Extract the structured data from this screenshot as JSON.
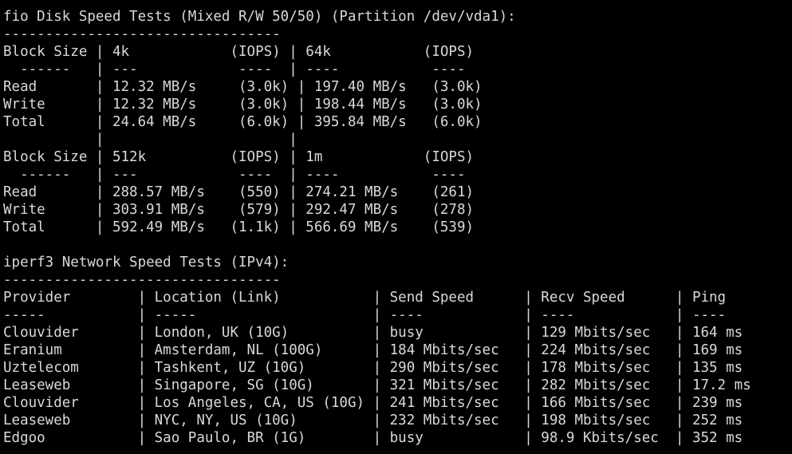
{
  "terminal": {
    "lines": [
      "fio Disk Speed Tests (Mixed R/W 50/50) (Partition /dev/vda1):",
      "---------------------------------",
      "Block Size | 4k            (IOPS) | 64k           (IOPS)",
      "  ------   | ---            ----  | ----           ----",
      "Read       | 12.32 MB/s     (3.0k) | 197.40 MB/s   (3.0k)",
      "Write      | 12.32 MB/s     (3.0k) | 198.44 MB/s   (3.0k)",
      "Total      | 24.64 MB/s     (6.0k) | 395.84 MB/s   (6.0k)",
      "           |                      |",
      "Block Size | 512k          (IOPS) | 1m            (IOPS)",
      "  ------   | ---            ----  | ----           ----",
      "Read       | 288.57 MB/s    (550) | 274.21 MB/s    (261)",
      "Write      | 303.91 MB/s    (579) | 292.47 MB/s    (278)",
      "Total      | 592.49 MB/s   (1.1k) | 566.69 MB/s    (539)",
      "",
      "iperf3 Network Speed Tests (IPv4):",
      "---------------------------------",
      "Provider        | Location (Link)           | Send Speed      | Recv Speed      | Ping",
      "-----           | -----                     | ----            | ----            | ----",
      "Clouvider       | London, UK (10G)          | busy            | 129 Mbits/sec   | 164 ms",
      "Eranium         | Amsterdam, NL (100G)      | 184 Mbits/sec   | 224 Mbits/sec   | 169 ms",
      "Uztelecom       | Tashkent, UZ (10G)        | 290 Mbits/sec   | 178 Mbits/sec   | 135 ms",
      "Leaseweb        | Singapore, SG (10G)       | 321 Mbits/sec   | 282 Mbits/sec   | 17.2 ms",
      "Clouvider       | Los Angeles, CA, US (10G) | 241 Mbits/sec   | 166 Mbits/sec   | 239 ms",
      "Leaseweb        | NYC, NY, US (10G)         | 232 Mbits/sec   | 198 Mbits/sec   | 252 ms",
      "Edgoo           | Sao Paulo, BR (1G)        | busy            | 98.9 Kbits/sec  | 352 ms"
    ]
  },
  "style": {
    "background": "#000000",
    "text_color": "#d9d9d9"
  }
}
